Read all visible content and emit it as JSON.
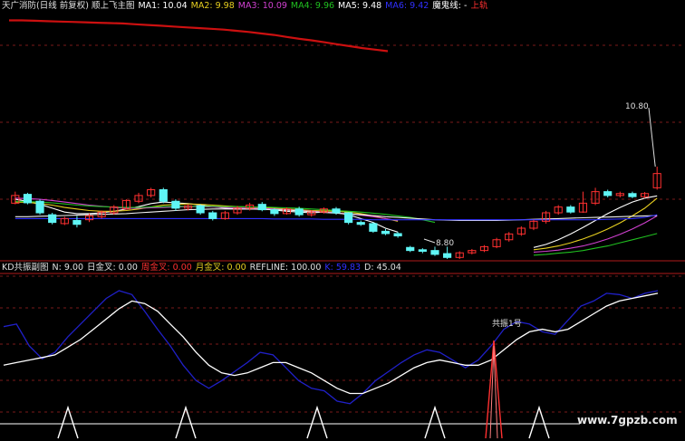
{
  "colors": {
    "background": "#000000",
    "text_white": "#e0e0e0",
    "red": "#ff3030",
    "cyan": "#5ff5f5",
    "green": "#20c020",
    "magenta": "#d040d0",
    "blue": "#3030ff",
    "ma_dark_red": "#cc1010",
    "k_line": "#2020c8",
    "d_line": "#ffffff",
    "grid_dashed": "#7a1a1a",
    "divider": "#b01a1a"
  },
  "main_header": {
    "title": "天广消防(日线 前复权) 顺上飞主图",
    "ma1": "MA1: 10.04",
    "ma2": "MA2: 9.98",
    "ma3": "MA3: 10.09",
    "ma4": "MA4: 9.96",
    "ma5": "MA5: 9.48",
    "ma6": "MA6: 9.42",
    "demon": "魔鬼线: -",
    "rail": "上轨"
  },
  "sub_header": {
    "title": "KD共振副图",
    "n": "N: 9.00",
    "day_gold": "日金叉: 0.00",
    "week_gold": "周金叉: 0.00",
    "month_gold": "月金叉: 0.00",
    "refline": "REFLINE: 100.00",
    "k": "K: 59.83",
    "d": "D: 45.04"
  },
  "watermark": "www.7gpzb.com",
  "chart_data": [
    {
      "type": "candlestick",
      "annotations": [
        {
          "label": "10.80",
          "kind": "high"
        },
        {
          "label": "8.80",
          "kind": "low"
        }
      ],
      "candles": [
        {
          "o": 9.85,
          "c": 10.05,
          "h": 10.15,
          "l": 9.82
        },
        {
          "o": 10.08,
          "c": 9.86,
          "h": 10.12,
          "l": 9.82
        },
        {
          "o": 9.9,
          "c": 9.6,
          "h": 9.95,
          "l": 9.55
        },
        {
          "o": 9.55,
          "c": 9.35,
          "h": 9.6,
          "l": 9.3
        },
        {
          "o": 9.32,
          "c": 9.45,
          "h": 9.5,
          "l": 9.28
        },
        {
          "o": 9.4,
          "c": 9.3,
          "h": 9.52,
          "l": 9.22
        },
        {
          "o": 9.42,
          "c": 9.52,
          "h": 9.58,
          "l": 9.36
        },
        {
          "o": 9.5,
          "c": 9.62,
          "h": 9.66,
          "l": 9.45
        },
        {
          "o": 9.6,
          "c": 9.75,
          "h": 9.8,
          "l": 9.55
        },
        {
          "o": 9.7,
          "c": 9.92,
          "h": 9.95,
          "l": 9.68
        },
        {
          "o": 9.9,
          "c": 10.05,
          "h": 10.12,
          "l": 9.85
        },
        {
          "o": 10.05,
          "c": 10.2,
          "h": 10.25,
          "l": 10.0
        },
        {
          "o": 10.2,
          "c": 9.9,
          "h": 10.25,
          "l": 9.85
        },
        {
          "o": 9.9,
          "c": 9.72,
          "h": 9.95,
          "l": 9.65
        },
        {
          "o": 9.72,
          "c": 9.78,
          "h": 9.82,
          "l": 9.66
        },
        {
          "o": 9.78,
          "c": 9.6,
          "h": 9.82,
          "l": 9.55
        },
        {
          "o": 9.6,
          "c": 9.45,
          "h": 9.65,
          "l": 9.4
        },
        {
          "o": 9.45,
          "c": 9.6,
          "h": 9.65,
          "l": 9.42
        },
        {
          "o": 9.6,
          "c": 9.72,
          "h": 9.78,
          "l": 9.55
        },
        {
          "o": 9.72,
          "c": 9.8,
          "h": 9.86,
          "l": 9.66
        },
        {
          "o": 9.82,
          "c": 9.68,
          "h": 9.88,
          "l": 9.64
        },
        {
          "o": 9.68,
          "c": 9.58,
          "h": 9.72,
          "l": 9.52
        },
        {
          "o": 9.58,
          "c": 9.7,
          "h": 9.74,
          "l": 9.55
        },
        {
          "o": 9.7,
          "c": 9.55,
          "h": 9.76,
          "l": 9.5
        },
        {
          "o": 9.55,
          "c": 9.62,
          "h": 9.67,
          "l": 9.5
        },
        {
          "o": 9.62,
          "c": 9.7,
          "h": 9.74,
          "l": 9.58
        },
        {
          "o": 9.7,
          "c": 9.6,
          "h": 9.75,
          "l": 9.55
        },
        {
          "o": 9.6,
          "c": 9.35,
          "h": 9.62,
          "l": 9.3
        },
        {
          "o": 9.35,
          "c": 9.3,
          "h": 9.4,
          "l": 9.26
        },
        {
          "o": 9.32,
          "c": 9.12,
          "h": 9.35,
          "l": 9.08
        },
        {
          "o": 9.12,
          "c": 9.06,
          "h": 9.18,
          "l": 9.02
        },
        {
          "o": 9.06,
          "c": 9.0,
          "h": 9.1,
          "l": 8.95
        },
        {
          "o": 8.7,
          "c": 8.62,
          "h": 8.74,
          "l": 8.58
        },
        {
          "o": 8.64,
          "c": 8.6,
          "h": 8.68,
          "l": 8.55
        },
        {
          "o": 8.62,
          "c": 8.52,
          "h": 8.72,
          "l": 8.48
        },
        {
          "o": 8.54,
          "c": 8.44,
          "h": 8.72,
          "l": 8.4
        },
        {
          "o": 8.44,
          "c": 8.56,
          "h": 8.6,
          "l": 8.4
        },
        {
          "o": 8.56,
          "c": 8.62,
          "h": 8.66,
          "l": 8.52
        },
        {
          "o": 8.62,
          "c": 8.72,
          "h": 8.76,
          "l": 8.58
        },
        {
          "o": 8.72,
          "c": 8.9,
          "h": 8.95,
          "l": 8.68
        },
        {
          "o": 8.9,
          "c": 9.05,
          "h": 9.1,
          "l": 8.85
        },
        {
          "o": 9.05,
          "c": 9.2,
          "h": 9.25,
          "l": 9.0
        },
        {
          "o": 9.2,
          "c": 9.38,
          "h": 9.42,
          "l": 9.15
        },
        {
          "o": 9.38,
          "c": 9.6,
          "h": 9.65,
          "l": 9.32
        },
        {
          "o": 9.6,
          "c": 9.75,
          "h": 9.8,
          "l": 9.55
        },
        {
          "o": 9.75,
          "c": 9.62,
          "h": 9.8,
          "l": 9.58
        },
        {
          "o": 9.62,
          "c": 9.85,
          "h": 10.15,
          "l": 9.6
        },
        {
          "o": 9.85,
          "c": 10.15,
          "h": 10.25,
          "l": 9.8
        },
        {
          "o": 10.15,
          "c": 10.05,
          "h": 10.2,
          "l": 10.0
        },
        {
          "o": 10.05,
          "c": 10.1,
          "h": 10.15,
          "l": 10.0
        },
        {
          "o": 10.1,
          "c": 10.02,
          "h": 10.15,
          "l": 9.98
        },
        {
          "o": 10.02,
          "c": 10.1,
          "h": 10.14,
          "l": 9.98
        },
        {
          "o": 10.25,
          "c": 10.62,
          "h": 10.8,
          "l": 10.2
        }
      ],
      "moving_averages": [
        {
          "name": "MA1",
          "color": "#ffffff",
          "values": [
            9.95,
            9.9,
            9.82,
            9.72,
            9.62,
            9.58,
            9.58,
            9.6,
            9.64,
            9.7,
            9.76,
            9.84,
            9.88,
            9.86,
            9.84,
            9.8,
            9.76,
            9.72,
            9.7,
            9.7,
            9.7,
            9.67,
            9.64,
            9.62,
            9.6,
            9.62,
            9.6,
            9.55,
            9.45,
            9.35,
            9.2,
            9.1,
            null,
            null,
            null,
            null,
            null,
            null,
            null,
            null,
            null,
            null,
            8.7,
            8.78,
            8.9,
            9.05,
            9.22,
            9.4,
            9.58,
            9.74,
            9.88,
            9.98,
            10.04
          ]
        },
        {
          "name": "MA2",
          "color": "#e8d020",
          "values": [
            9.88,
            9.87,
            9.84,
            9.8,
            9.74,
            9.7,
            9.66,
            9.64,
            9.64,
            9.66,
            9.7,
            9.75,
            9.8,
            9.82,
            9.83,
            9.82,
            9.8,
            9.78,
            9.76,
            9.75,
            9.74,
            9.72,
            9.7,
            9.68,
            9.66,
            9.65,
            9.64,
            9.62,
            9.58,
            9.52,
            9.45,
            9.38,
            null,
            null,
            null,
            null,
            null,
            null,
            null,
            null,
            null,
            null,
            8.64,
            8.68,
            8.74,
            8.82,
            8.92,
            9.04,
            9.18,
            9.34,
            9.52,
            9.72,
            9.98
          ]
        },
        {
          "name": "MA3",
          "color": "#d040d0",
          "values": [
            9.98,
            9.97,
            9.95,
            9.92,
            9.88,
            9.84,
            9.8,
            9.77,
            9.74,
            9.72,
            9.72,
            9.73,
            9.74,
            9.75,
            9.76,
            9.76,
            9.75,
            9.74,
            9.73,
            9.72,
            9.71,
            9.7,
            9.68,
            9.66,
            9.64,
            9.62,
            9.6,
            9.57,
            9.54,
            9.5,
            9.45,
            9.4,
            null,
            null,
            null,
            null,
            null,
            null,
            null,
            null,
            null,
            null,
            8.58,
            8.6,
            8.63,
            8.68,
            8.74,
            8.82,
            8.92,
            9.04,
            9.18,
            9.34,
            9.52
          ]
        },
        {
          "name": "MA4",
          "color": "#20c020",
          "values": [
            9.9,
            9.89,
            9.88,
            9.86,
            9.83,
            9.8,
            9.78,
            9.76,
            9.75,
            9.74,
            9.74,
            9.75,
            9.76,
            9.77,
            9.77,
            9.77,
            9.77,
            9.76,
            9.76,
            9.75,
            9.75,
            9.74,
            9.73,
            9.72,
            9.7,
            9.68,
            9.66,
            9.64,
            9.62,
            9.59,
            9.56,
            9.52,
            9.48,
            9.42,
            9.35,
            null,
            null,
            null,
            null,
            null,
            null,
            null,
            8.5,
            8.52,
            8.55,
            8.58,
            8.62,
            8.68,
            8.74,
            8.82,
            8.9,
            8.98,
            9.06
          ]
        },
        {
          "name": "MA5",
          "color": "#f0f0f0",
          "values": [
            9.5,
            9.5,
            9.51,
            9.52,
            9.53,
            9.54,
            9.55,
            9.56,
            9.57,
            9.58,
            9.6,
            9.62,
            9.64,
            9.66,
            9.68,
            9.69,
            9.7,
            9.7,
            9.7,
            9.7,
            9.69,
            9.68,
            9.67,
            9.65,
            9.63,
            9.61,
            9.59,
            9.57,
            9.55,
            9.53,
            9.5,
            9.48,
            9.46,
            9.44,
            9.42,
            9.41,
            9.4,
            9.4,
            9.4,
            9.4,
            9.41,
            9.42,
            9.43,
            9.44,
            9.45,
            9.46,
            9.47,
            9.48,
            9.49,
            9.5,
            9.51,
            9.52,
            9.53
          ]
        },
        {
          "name": "MA6",
          "color": "#3030ff",
          "values": [
            9.45,
            9.45,
            9.45,
            9.45,
            9.45,
            9.45,
            9.45,
            9.45,
            9.45,
            9.45,
            9.45,
            9.45,
            9.45,
            9.45,
            9.45,
            9.45,
            9.45,
            9.45,
            9.45,
            9.45,
            9.45,
            9.44,
            9.44,
            9.44,
            9.44,
            9.43,
            9.43,
            9.43,
            9.43,
            9.42,
            9.42,
            9.42,
            9.42,
            9.42,
            9.42,
            9.42,
            9.42,
            9.42,
            9.42,
            9.42,
            9.42,
            9.42,
            9.42,
            9.42,
            9.42,
            9.42,
            9.42,
            9.42,
            9.43,
            9.44,
            9.45,
            9.48,
            9.55
          ]
        },
        {
          "name": "魔鬼线",
          "color": "#cc1010",
          "values": [
            14.6,
            14.6,
            14.59,
            14.58,
            14.57,
            14.56,
            14.55,
            14.54,
            14.53,
            14.52,
            14.5,
            14.48,
            14.46,
            14.44,
            14.42,
            14.4,
            14.38,
            14.36,
            14.33,
            14.3,
            14.26,
            14.22,
            14.17,
            14.12,
            14.08,
            14.03,
            13.98,
            13.93,
            13.88,
            13.84,
            13.8
          ]
        }
      ],
      "ylim": [
        8.4,
        14.8
      ]
    },
    {
      "type": "line",
      "ylim": [
        0,
        110
      ],
      "series": [
        {
          "name": "K",
          "color": "#2020c8",
          "values": [
            70,
            72,
            55,
            45,
            50,
            62,
            72,
            82,
            92,
            98,
            95,
            82,
            68,
            55,
            40,
            28,
            22,
            28,
            35,
            42,
            50,
            48,
            38,
            28,
            22,
            20,
            12,
            10,
            18,
            28,
            35,
            42,
            48,
            52,
            50,
            44,
            38,
            44,
            55,
            68,
            74,
            72,
            66,
            64,
            75,
            86,
            90,
            96,
            95,
            92,
            96,
            98
          ]
        },
        {
          "name": "D",
          "color": "#ffffff",
          "values": [
            40,
            42,
            44,
            46,
            48,
            54,
            60,
            68,
            76,
            84,
            90,
            88,
            82,
            72,
            62,
            50,
            40,
            34,
            32,
            34,
            38,
            42,
            42,
            38,
            34,
            28,
            22,
            18,
            18,
            22,
            26,
            32,
            38,
            42,
            44,
            42,
            40,
            40,
            44,
            52,
            60,
            66,
            68,
            66,
            68,
            74,
            80,
            86,
            90,
            92,
            94,
            96
          ]
        }
      ],
      "signals": [
        {
          "kind": "triangle",
          "color": "#ffffff"
        },
        {
          "kind": "triangle",
          "color": "#ffffff"
        },
        {
          "kind": "triangle",
          "color": "#ffffff"
        },
        {
          "kind": "triangle",
          "color": "#ffffff"
        },
        {
          "kind": "triangle",
          "color": "#ff3030",
          "label": "共振1号"
        },
        {
          "kind": "triangle",
          "color": "#ffffff"
        }
      ]
    }
  ]
}
